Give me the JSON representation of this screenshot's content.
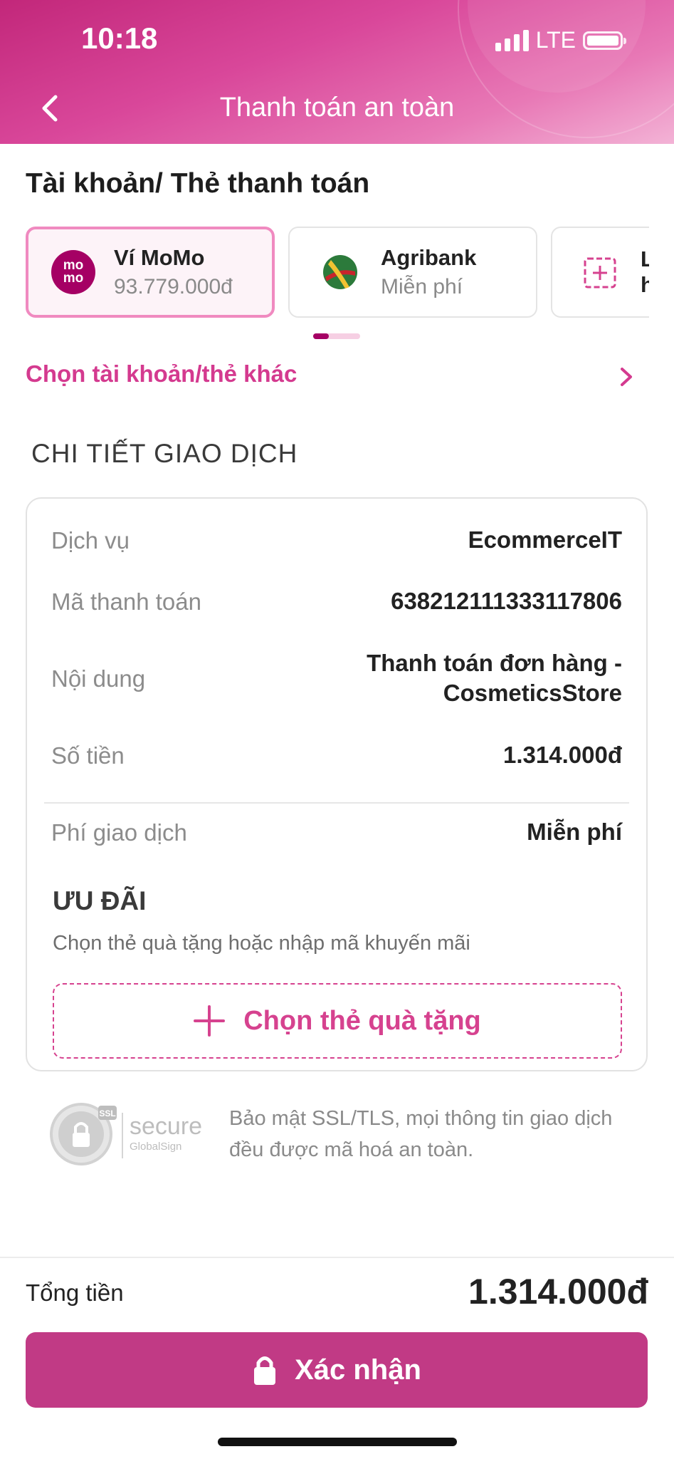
{
  "status_bar": {
    "time": "10:18",
    "network": "LTE"
  },
  "header": {
    "title": "Thanh toán an toàn"
  },
  "accounts": {
    "title": "Tài khoản/ Thẻ thanh toán",
    "items": [
      {
        "name": "Ví MoMo",
        "sub": "93.779.000đ",
        "logo_text_1": "mo",
        "logo_text_2": "mo",
        "selected": true
      },
      {
        "name": "Agribank",
        "sub": "Miễn phí",
        "selected": false
      },
      {
        "name": "Li",
        "sub": "h",
        "selected": false
      }
    ],
    "choose_other": "Chọn tài khoản/thẻ khác"
  },
  "details": {
    "title": "CHI TIẾT GIAO DỊCH",
    "rows": [
      {
        "label": "Dịch vụ",
        "value": "EcommerceIT"
      },
      {
        "label": "Mã thanh toán",
        "value": "638212111333117806"
      },
      {
        "label": "Nội dung",
        "value_line1": "Thanh toán đơn hàng -",
        "value_line2": "CosmeticsStore"
      },
      {
        "label": "Số tiền",
        "value": "1.314.000đ"
      },
      {
        "label": "Phí giao dịch",
        "value": "Miễn phí"
      }
    ],
    "promo_title": "ƯU ĐÃI",
    "promo_sub": "Chọn thẻ quà tặng hoặc nhập mã khuyến mãi",
    "gift_button": "Chọn thẻ quà tặng"
  },
  "security": {
    "logo_secure": "secure",
    "logo_brand": "GlobalSign",
    "logo_ssl": "SSL",
    "text": "Bảo mật SSL/TLS, mọi thông tin giao dịch đều được mã hoá an toàn."
  },
  "footer": {
    "total_label": "Tổng tiền",
    "total_value": "1.314.000đ",
    "confirm_label": "Xác nhận"
  },
  "colors": {
    "brand": "#c13a85",
    "accent_text": "#d43a8f",
    "momo": "#a50064"
  }
}
